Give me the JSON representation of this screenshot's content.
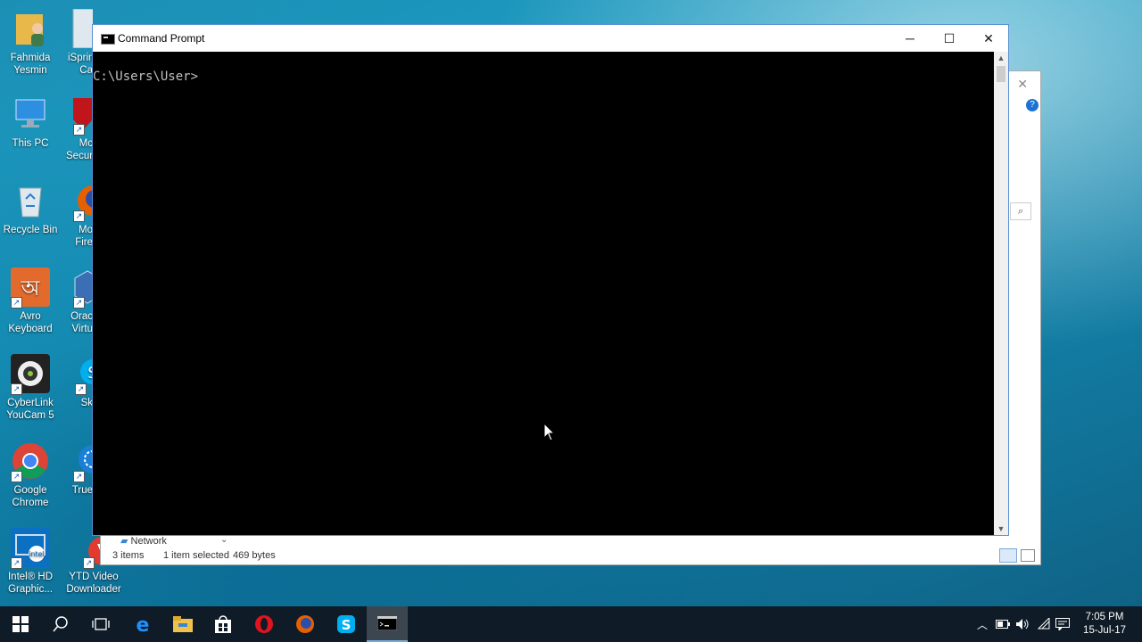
{
  "desktop": {
    "icons_col1": [
      {
        "label_1": "Fahmida",
        "label_2": "Yesmin",
        "icon": "user-folder-icon"
      },
      {
        "label_1": "This PC",
        "label_2": "",
        "icon": "monitor-icon"
      },
      {
        "label_1": "Recycle Bin",
        "label_2": "",
        "icon": "recycle-bin-icon"
      },
      {
        "label_1": "Avro",
        "label_2": "Keyboard",
        "icon": "avro-keyboard-icon"
      },
      {
        "label_1": "CyberLink",
        "label_2": "YouCam 5",
        "icon": "webcam-icon"
      },
      {
        "label_1": "Google",
        "label_2": "Chrome",
        "icon": "chrome-icon"
      },
      {
        "label_1": "Intel® HD",
        "label_2": "Graphic...",
        "icon": "intel-graphics-icon"
      }
    ],
    "icons_col2": [
      {
        "label_1": "iSprin",
        "label_2": "Ca",
        "icon": "ispring-icon"
      },
      {
        "label_1": "Mc",
        "label_2": "Secur",
        "icon": "mcafee-icon"
      },
      {
        "label_1": "Mo",
        "label_2": "Fire",
        "icon": "firefox-icon"
      },
      {
        "label_1": "Orac",
        "label_2": "Virtu",
        "icon": "virtualbox-icon"
      },
      {
        "label_1": "Sk",
        "label_2": "",
        "icon": "skype-icon"
      },
      {
        "label_1": "True",
        "label_2": "",
        "icon": "truecaller-icon"
      },
      {
        "label_1": "YTD Video",
        "label_2": "Downloader",
        "icon": "ytd-downloader-icon"
      }
    ]
  },
  "explorer": {
    "nav_item": "Network",
    "status_items": "3 items",
    "status_selected": "1 item selected",
    "status_size": "469 bytes"
  },
  "cmd": {
    "title": "Command Prompt",
    "prompt": "C:\\Users\\User>",
    "minimize": "─",
    "maximize": "☐",
    "close": "✕"
  },
  "taskbar": {
    "time": "7:05 PM",
    "date": "15-Jul-17",
    "items": [
      "start",
      "search",
      "task-view",
      "edge",
      "file-explorer",
      "store",
      "opera",
      "firefox",
      "skype",
      "command-prompt"
    ]
  },
  "colors": {
    "taskbar": "#0f1b26",
    "console_bg": "#000000",
    "console_text": "#c0c0c0",
    "window_border": "#5a8fd6"
  }
}
